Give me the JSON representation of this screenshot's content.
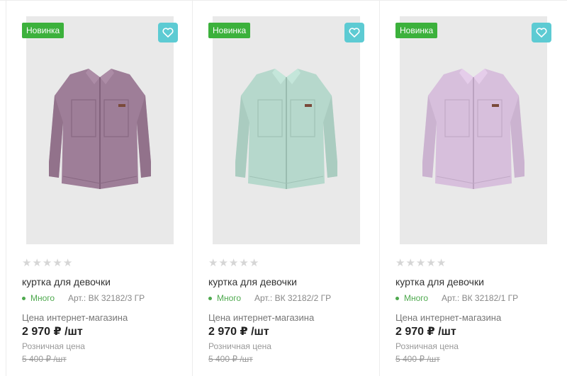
{
  "colors": {
    "badge": "#3cb13c",
    "favorite_button": "#5dcbd3",
    "in_stock": "#4ea94e",
    "photo_background": "#e9e9e9"
  },
  "products": [
    {
      "badge": "Новинка",
      "favorite_icon": "heart-icon",
      "rating": 0,
      "title": "куртка для девочки",
      "stock": "Много",
      "article": "Арт.: ВК 32182/3 ГР",
      "price_label": "Цена интернет-магазина",
      "price": "2 970 ₽ /шт",
      "retail_label": "Розничная цена",
      "retail_price": "5 400 ₽ /шт",
      "garment_color": "#9e7e98"
    },
    {
      "badge": "Новинка",
      "favorite_icon": "heart-icon",
      "rating": 0,
      "title": "куртка для девочки",
      "stock": "Много",
      "article": "Арт.: ВК 32182/2 ГР",
      "price_label": "Цена интернет-магазина",
      "price": "2 970 ₽ /шт",
      "retail_label": "Розничная цена",
      "retail_price": "5 400 ₽ /шт",
      "garment_color": "#b6d8cc"
    },
    {
      "badge": "Новинка",
      "favorite_icon": "heart-icon",
      "rating": 0,
      "title": "куртка для девочки",
      "stock": "Много",
      "article": "Арт.: ВК 32182/1 ГР",
      "price_label": "Цена интернет-магазина",
      "price": "2 970 ₽ /шт",
      "retail_label": "Розничная цена",
      "retail_price": "5 400 ₽ /шт",
      "garment_color": "#d7bfdc"
    }
  ]
}
